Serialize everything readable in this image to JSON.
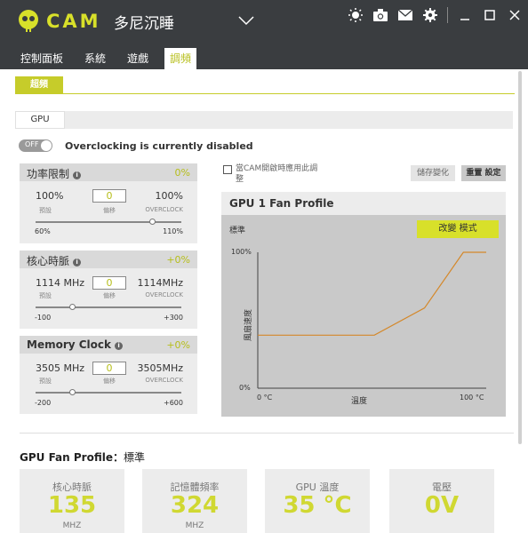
{
  "app": {
    "logo_text": "CAM",
    "user_name": "多尼沉睡"
  },
  "tabs": [
    {
      "label": "控制面板"
    },
    {
      "label": "系統"
    },
    {
      "label": "遊戲"
    },
    {
      "label": "調頻"
    }
  ],
  "subtab": {
    "label": "超頻"
  },
  "gpu_tab": {
    "label": "GPU"
  },
  "overclock": {
    "toggle_label": "OFF",
    "status_text": "Overclocking is currently disabled"
  },
  "power_limit": {
    "title": "功率限制",
    "value": "0%",
    "current": "100%",
    "offset": "0",
    "max": "100%",
    "label_default": "預設",
    "label_offset": "偏移",
    "label_overclock": "OVERCLOCK",
    "range_min": "60%",
    "range_max": "110%",
    "slider_level": 0.8
  },
  "core_clock": {
    "title": "核心時脈",
    "value": "+0%",
    "current": "1114 MHz",
    "offset": "0",
    "max": "1114MHz",
    "label_default": "預設",
    "label_offset": "偏移",
    "label_overclock": "OVERCLOCK",
    "range_min": "-100",
    "range_max": "+300",
    "slider_level": 0.25
  },
  "memory_clock": {
    "title": "Memory Clock",
    "value": "+0%",
    "current": "3505 MHz",
    "offset": "0",
    "max": "3505MHz",
    "label_default": "預設",
    "label_offset": "偏移",
    "label_overclock": "OVERCLOCK",
    "range_min": "-200",
    "range_max": "+600",
    "slider_level": 0.25
  },
  "apply_on_start": {
    "label": "當CAM開啟時應用此調整"
  },
  "buttons": {
    "save": "儲存變化",
    "reset": "重置 設定",
    "change_mode": "改變 模式"
  },
  "fan_profile": {
    "title": "GPU 1 Fan Profile",
    "mode": "標準",
    "y_max_label": "100%",
    "y_min_label": "0%",
    "y_axis_label": "風扇速度",
    "x_min_label": "0 °C",
    "x_mid_label": "溫度",
    "x_max_label": "100 °C",
    "line_color": "#d4882a"
  },
  "chart_data": {
    "type": "line",
    "title": "GPU 1 Fan Profile",
    "xlabel": "溫度",
    "ylabel": "風扇速度",
    "xlim": [
      0,
      100
    ],
    "ylim": [
      0,
      100
    ],
    "x": [
      0,
      51,
      73,
      90,
      100
    ],
    "y": [
      39,
      39,
      59,
      100,
      100
    ]
  },
  "bottom": {
    "title_prefix": "GPU Fan Profile：",
    "title_mode": "標準",
    "stats": [
      {
        "label": "核心時脈",
        "value": "135",
        "unit": "MHZ"
      },
      {
        "label": "記憶體頻率",
        "value": "324",
        "unit": "MHZ"
      },
      {
        "label": "GPU 溫度",
        "value": "35 °C",
        "unit": ""
      },
      {
        "label": "電壓",
        "value": "0V",
        "unit": ""
      }
    ]
  },
  "colors": {
    "accent": "#d8e02a",
    "header_bg": "#3a3d40"
  }
}
